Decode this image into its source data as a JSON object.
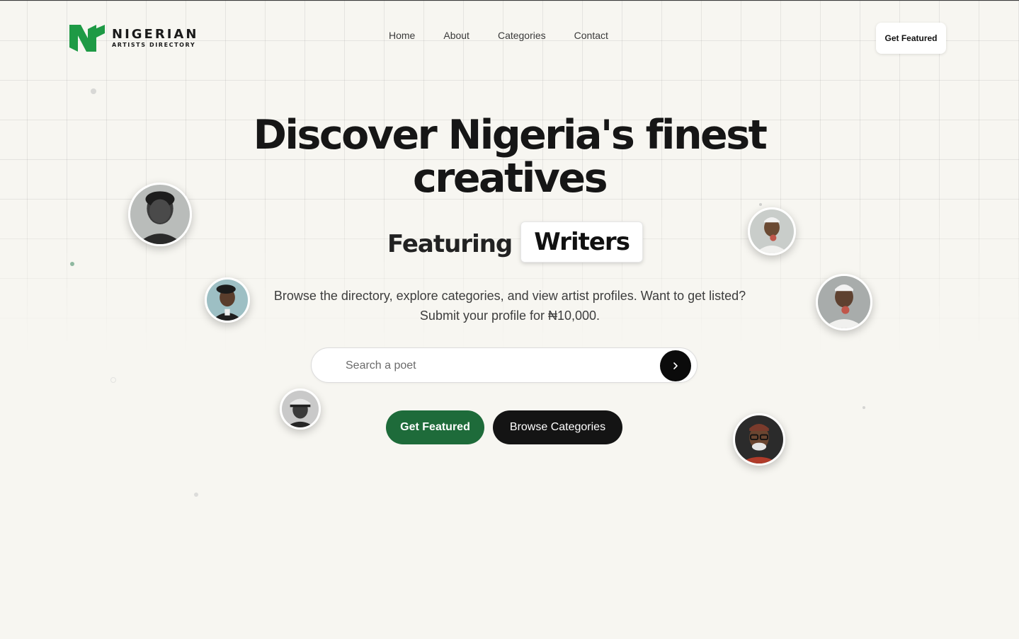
{
  "brand": {
    "name": "NIGERIAN",
    "tagline": "ARTISTS DIRECTORY",
    "logo_color": "#1e9a45"
  },
  "nav": {
    "items": [
      "Home",
      "About",
      "Categories",
      "Contact"
    ],
    "cta_label": "Get Featured"
  },
  "hero": {
    "title": "Discover Nigeria's finest creatives",
    "featuring_label": "Featuring",
    "featuring_word": "Writers",
    "subtitle": "Browse the directory, explore categories, and view artist profiles. Want to get listed? Submit your profile for ₦10,000."
  },
  "search": {
    "placeholder": "Search a poet",
    "value": ""
  },
  "actions": {
    "primary_label": "Get Featured",
    "secondary_label": "Browse Categories"
  },
  "colors": {
    "background": "#f7f6f1",
    "accent_green": "#1e6b3a",
    "dark": "#141414"
  },
  "avatars": [
    "portrait-elder-man",
    "portrait-man-beret",
    "portrait-man-cap",
    "portrait-man-microphone",
    "portrait-man-microphone",
    "portrait-man-glasses"
  ]
}
